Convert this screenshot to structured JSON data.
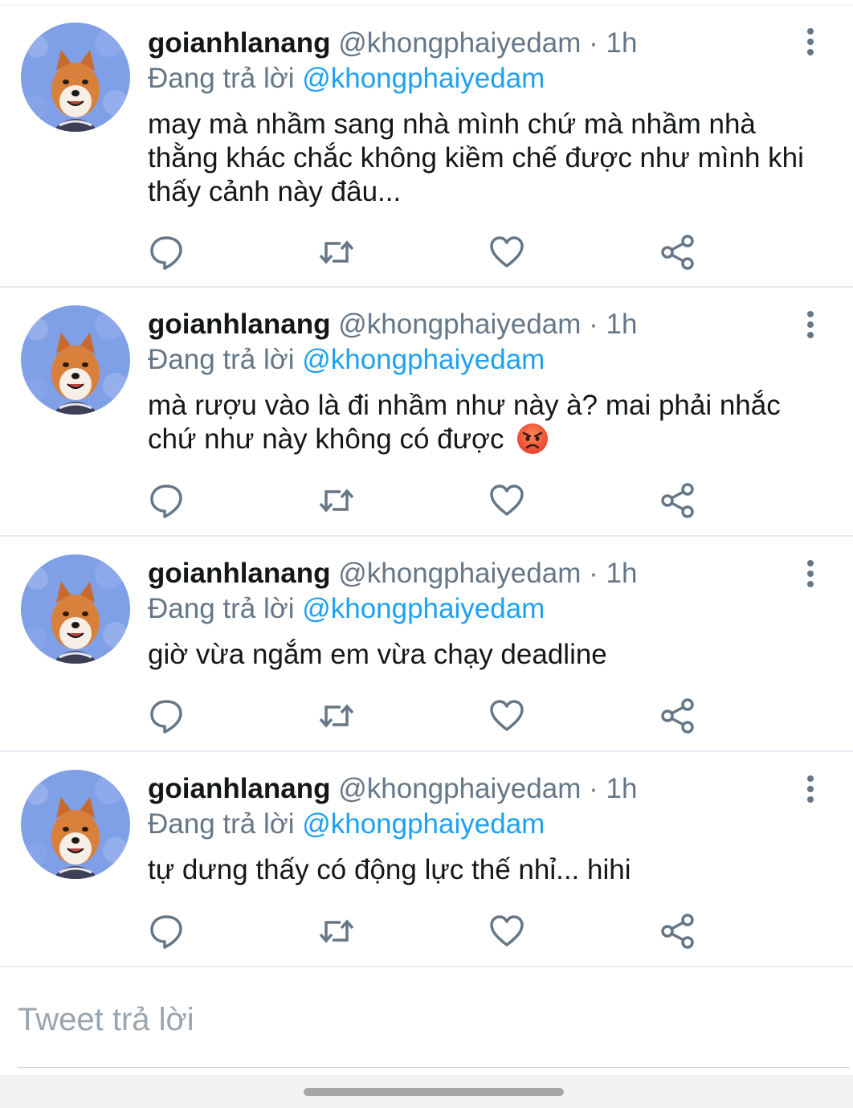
{
  "tweets": [
    {
      "name": "goianhlanang",
      "handle": "@khongphaiyedam",
      "separator": "·",
      "time": "1h",
      "replying_prefix": "Đang trả lời",
      "replying_to": "@khongphaiyedam",
      "text": "may mà nhầm sang nhà mình chứ mà nhầm nhà thằng khác chắc không kiềm chế được như mình khi thấy cảnh này đâu...",
      "emoji": ""
    },
    {
      "name": "goianhlanang",
      "handle": "@khongphaiyedam",
      "separator": "·",
      "time": "1h",
      "replying_prefix": "Đang trả lời",
      "replying_to": "@khongphaiyedam",
      "text": "mà rượu vào là đi nhầm như này à? mai phải nhắc chứ như này không có được",
      "emoji": "angry-face"
    },
    {
      "name": "goianhlanang",
      "handle": "@khongphaiyedam",
      "separator": "·",
      "time": "1h",
      "replying_prefix": "Đang trả lời",
      "replying_to": "@khongphaiyedam",
      "text": "giờ vừa ngắm em vừa chạy deadline",
      "emoji": ""
    },
    {
      "name": "goianhlanang",
      "handle": "@khongphaiyedam",
      "separator": "·",
      "time": "1h",
      "replying_prefix": "Đang trả lời",
      "replying_to": "@khongphaiyedam",
      "text": "tự dưng thấy có động lực thế nhỉ... hihi",
      "emoji": ""
    }
  ],
  "actions": [
    "reply-icon",
    "retweet-icon",
    "like-icon",
    "share-icon"
  ],
  "reply_box": {
    "placeholder": "Tweet trả lời"
  },
  "colors": {
    "text": "#14171a",
    "secondary": "#657786",
    "accent": "#1da1f2",
    "divider": "#e6ecf0",
    "icon": "#657786"
  }
}
